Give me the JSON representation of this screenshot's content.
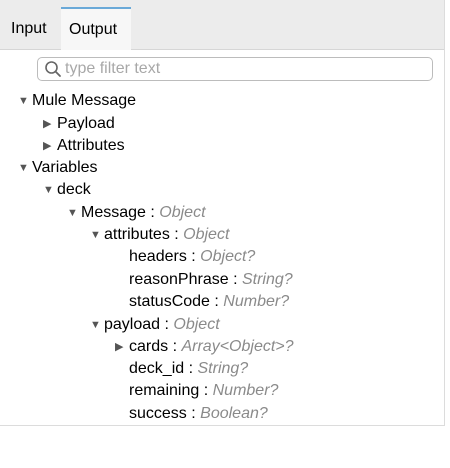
{
  "tabs": {
    "input_label": "Input",
    "output_label": "Output"
  },
  "filter": {
    "placeholder": "type filter text"
  },
  "tree": {
    "mule_message": "Mule Message",
    "payload": "Payload",
    "attributes": "Attributes",
    "variables": "Variables",
    "deck": "deck",
    "message": {
      "name": "Message",
      "type": "Object"
    },
    "msg_attributes": {
      "name": "attributes",
      "type": "Object"
    },
    "headers": {
      "name": "headers",
      "type": "Object?"
    },
    "reason_phrase": {
      "name": "reasonPhrase",
      "type": "String?"
    },
    "status_code": {
      "name": "statusCode",
      "type": "Number?"
    },
    "msg_payload": {
      "name": "payload",
      "type": "Object"
    },
    "cards": {
      "name": "cards",
      "type": "Array<Object>?"
    },
    "deck_id": {
      "name": "deck_id",
      "type": "String?"
    },
    "remaining": {
      "name": "remaining",
      "type": "Number?"
    },
    "success": {
      "name": "success",
      "type": "Boolean?"
    },
    "sep": " : ",
    "expanded_glyph": "▼",
    "collapsed_glyph": "▶"
  },
  "colors": {
    "tab_accent": "#6aa9d8",
    "type_text": "#8a8a8a"
  },
  "icons": {
    "filter": "search-icon"
  }
}
